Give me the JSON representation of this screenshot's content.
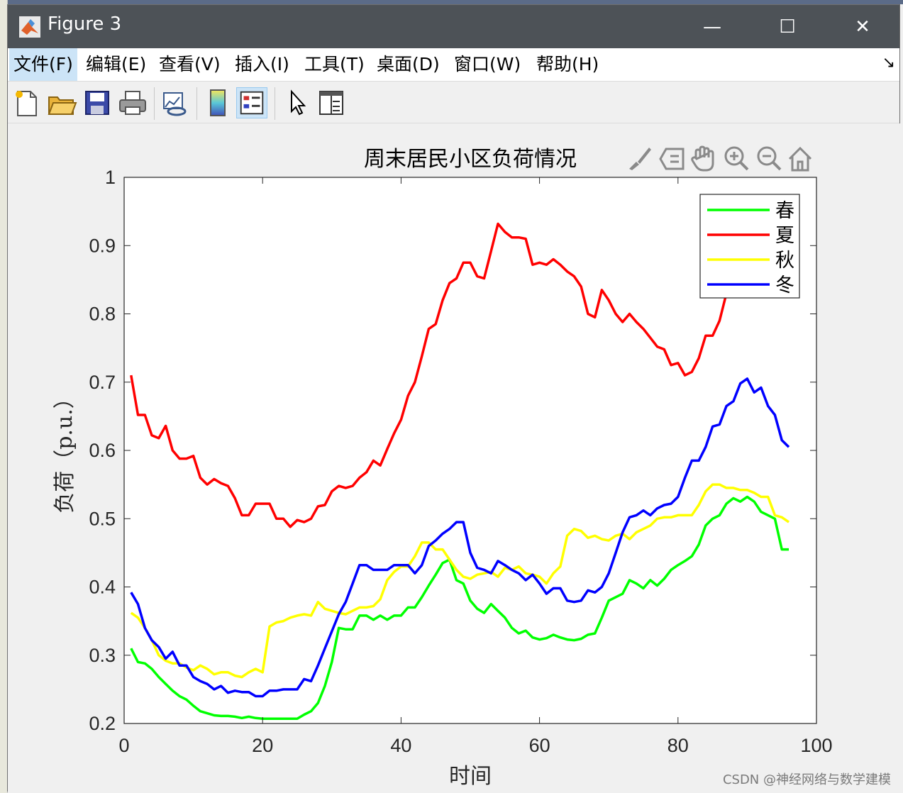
{
  "window": {
    "title": "Figure 3",
    "minimize": "—",
    "maximize": "☐",
    "close": "✕"
  },
  "menu": {
    "items": [
      "文件(F)",
      "编辑(E)",
      "查看(V)",
      "插入(I)",
      "工具(T)",
      "桌面(D)",
      "窗口(W)",
      "帮助(H)"
    ],
    "arrow": "↘"
  },
  "toolbar": {
    "icons": [
      "new-figure-icon",
      "open-file-icon",
      "save-icon",
      "print-icon",
      "link-plot-icon",
      "colorbar-icon",
      "legend-icon",
      "edit-plot-arrow-icon",
      "property-inspector-icon"
    ]
  },
  "axes_toolbar": {
    "icons": [
      "brush-icon",
      "datatip-icon",
      "pan-hand-icon",
      "zoom-in-icon",
      "zoom-out-icon",
      "home-icon"
    ]
  },
  "watermark": "CSDN @神经网络与数学建模",
  "colors": {
    "spring": "#00ff00",
    "summer": "#ff0000",
    "autumn": "#ffff00",
    "winter": "#0000ff"
  },
  "chart_data": {
    "type": "line",
    "title": "周末居民小区负荷情况",
    "xlabel": "时间",
    "ylabel": "负荷（p.u.）",
    "xlim": [
      0,
      100
    ],
    "ylim": [
      0.2,
      1
    ],
    "xticks": [
      0,
      20,
      40,
      60,
      80,
      100
    ],
    "yticks": [
      0.2,
      0.3,
      0.4,
      0.5,
      0.6,
      0.7,
      0.8,
      0.9,
      1
    ],
    "ytick_labels": [
      "0.2",
      "0.3",
      "0.4",
      "0.5",
      "0.6",
      "0.7",
      "0.8",
      "0.9",
      "1"
    ],
    "legend_position": "top-right",
    "grid": false,
    "x_start": 1,
    "series": [
      {
        "name": "春",
        "color": "#00ff00",
        "values": [
          0.31,
          0.29,
          0.288,
          0.28,
          0.268,
          0.258,
          0.248,
          0.24,
          0.235,
          0.226,
          0.218,
          0.215,
          0.212,
          0.211,
          0.211,
          0.21,
          0.208,
          0.21,
          0.208,
          0.207,
          0.207,
          0.207,
          0.207,
          0.207,
          0.207,
          0.213,
          0.218,
          0.23,
          0.255,
          0.29,
          0.34,
          0.338,
          0.338,
          0.358,
          0.358,
          0.352,
          0.358,
          0.352,
          0.358,
          0.358,
          0.37,
          0.37,
          0.385,
          0.402,
          0.418,
          0.435,
          0.44,
          0.41,
          0.405,
          0.38,
          0.368,
          0.362,
          0.375,
          0.365,
          0.355,
          0.34,
          0.332,
          0.336,
          0.326,
          0.323,
          0.325,
          0.33,
          0.326,
          0.323,
          0.322,
          0.324,
          0.33,
          0.332,
          0.355,
          0.38,
          0.385,
          0.39,
          0.41,
          0.405,
          0.398,
          0.41,
          0.402,
          0.412,
          0.425,
          0.432,
          0.438,
          0.445,
          0.462,
          0.49,
          0.5,
          0.505,
          0.522,
          0.53,
          0.525,
          0.532,
          0.525,
          0.51,
          0.505,
          0.5,
          0.455,
          0.455
        ]
      },
      {
        "name": "夏",
        "color": "#ff0000",
        "values": [
          0.71,
          0.652,
          0.652,
          0.622,
          0.618,
          0.636,
          0.6,
          0.588,
          0.588,
          0.592,
          0.56,
          0.55,
          0.558,
          0.552,
          0.548,
          0.53,
          0.505,
          0.505,
          0.522,
          0.522,
          0.522,
          0.5,
          0.5,
          0.488,
          0.498,
          0.495,
          0.5,
          0.518,
          0.52,
          0.54,
          0.548,
          0.545,
          0.548,
          0.56,
          0.568,
          0.585,
          0.578,
          0.602,
          0.625,
          0.645,
          0.68,
          0.7,
          0.738,
          0.778,
          0.785,
          0.82,
          0.845,
          0.852,
          0.875,
          0.875,
          0.855,
          0.852,
          0.892,
          0.932,
          0.92,
          0.912,
          0.912,
          0.91,
          0.872,
          0.875,
          0.872,
          0.88,
          0.872,
          0.862,
          0.855,
          0.84,
          0.8,
          0.795,
          0.835,
          0.82,
          0.8,
          0.788,
          0.8,
          0.788,
          0.778,
          0.765,
          0.752,
          0.748,
          0.725,
          0.728,
          0.71,
          0.715,
          0.735,
          0.768,
          0.768,
          0.79,
          0.83,
          0.87,
          0.89,
          0.9,
          0.91,
          0.915,
          0.92,
          0.925,
          0.93,
          0.935
        ]
      },
      {
        "name": "秋",
        "color": "#ffff00",
        "values": [
          0.362,
          0.355,
          0.34,
          0.322,
          0.3,
          0.292,
          0.288,
          0.288,
          0.282,
          0.278,
          0.285,
          0.28,
          0.272,
          0.275,
          0.275,
          0.27,
          0.268,
          0.275,
          0.28,
          0.275,
          0.342,
          0.348,
          0.35,
          0.355,
          0.358,
          0.36,
          0.358,
          0.378,
          0.368,
          0.365,
          0.362,
          0.36,
          0.365,
          0.37,
          0.37,
          0.372,
          0.382,
          0.41,
          0.422,
          0.43,
          0.43,
          0.445,
          0.465,
          0.465,
          0.455,
          0.455,
          0.44,
          0.425,
          0.415,
          0.412,
          0.418,
          0.42,
          0.422,
          0.415,
          0.428,
          0.425,
          0.43,
          0.42,
          0.418,
          0.415,
          0.405,
          0.42,
          0.43,
          0.475,
          0.485,
          0.482,
          0.472,
          0.475,
          0.47,
          0.468,
          0.475,
          0.478,
          0.47,
          0.48,
          0.485,
          0.49,
          0.5,
          0.502,
          0.502,
          0.505,
          0.505,
          0.505,
          0.52,
          0.54,
          0.55,
          0.55,
          0.545,
          0.545,
          0.542,
          0.542,
          0.538,
          0.532,
          0.532,
          0.505,
          0.502,
          0.495
        ]
      },
      {
        "name": "冬",
        "color": "#0000ff",
        "values": [
          0.392,
          0.375,
          0.34,
          0.322,
          0.312,
          0.295,
          0.305,
          0.285,
          0.285,
          0.268,
          0.262,
          0.258,
          0.25,
          0.255,
          0.245,
          0.248,
          0.246,
          0.246,
          0.24,
          0.24,
          0.248,
          0.248,
          0.25,
          0.25,
          0.25,
          0.265,
          0.262,
          0.285,
          0.31,
          0.335,
          0.36,
          0.378,
          0.405,
          0.432,
          0.432,
          0.425,
          0.425,
          0.425,
          0.432,
          0.432,
          0.432,
          0.42,
          0.432,
          0.46,
          0.468,
          0.478,
          0.485,
          0.495,
          0.495,
          0.45,
          0.428,
          0.425,
          0.42,
          0.438,
          0.432,
          0.425,
          0.42,
          0.41,
          0.418,
          0.405,
          0.39,
          0.398,
          0.398,
          0.38,
          0.378,
          0.38,
          0.395,
          0.392,
          0.4,
          0.42,
          0.45,
          0.48,
          0.502,
          0.505,
          0.512,
          0.505,
          0.515,
          0.52,
          0.522,
          0.532,
          0.56,
          0.585,
          0.585,
          0.605,
          0.635,
          0.638,
          0.665,
          0.672,
          0.698,
          0.705,
          0.685,
          0.692,
          0.665,
          0.652,
          0.615,
          0.605
        ]
      }
    ]
  }
}
